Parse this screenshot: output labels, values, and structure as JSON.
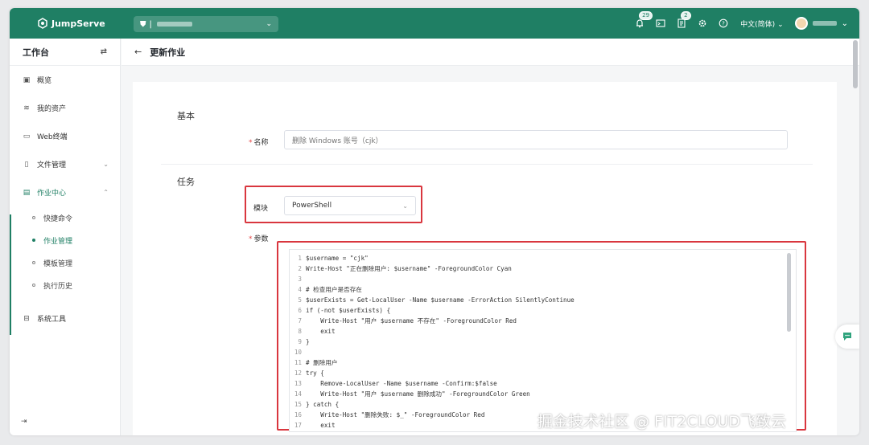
{
  "brand": {
    "name": "JumpServe",
    "color": "#1f7f64"
  },
  "topbar": {
    "org_icon": "org-icon",
    "org_separator": "|",
    "notifications_badge": "29",
    "tasks_badge": "2",
    "language": "中文(简体)"
  },
  "sidebar": {
    "header": "工作台",
    "toggle_icon": "⇄",
    "items": [
      {
        "label": "概览",
        "icon": "overview-icon"
      },
      {
        "label": "我的资产",
        "icon": "assets-icon"
      },
      {
        "label": "Web终端",
        "icon": "terminal-icon"
      },
      {
        "label": "文件管理",
        "icon": "file-icon"
      },
      {
        "label": "作业中心",
        "icon": "job-icon"
      },
      {
        "label": "系统工具",
        "icon": "tools-icon"
      }
    ],
    "sub_items": [
      {
        "label": "快捷命令"
      },
      {
        "label": "作业管理"
      },
      {
        "label": "模板管理"
      },
      {
        "label": "执行历史"
      }
    ]
  },
  "page": {
    "back_icon": "←",
    "title": "更新作业"
  },
  "form": {
    "section_basic": "基本",
    "name_label": "名称",
    "name_value": "删除 Windows 账号（cjk）",
    "section_task": "任务",
    "module_label": "模块",
    "module_value": "PowerShell",
    "params_label": "参数"
  },
  "code": {
    "lines": [
      {
        "no": "1",
        "text": "$username = \"cjk\""
      },
      {
        "no": "2",
        "text": "Write-Host \"正在删除用户: $username\" -ForegroundColor Cyan"
      },
      {
        "no": "3",
        "text": ""
      },
      {
        "no": "4",
        "text": "# 检查用户是否存在"
      },
      {
        "no": "5",
        "text": "$userExists = Get-LocalUser -Name $username -ErrorAction SilentlyContinue"
      },
      {
        "no": "6",
        "text": "if (-not $userExists) {"
      },
      {
        "no": "7",
        "text": "    Write-Host \"用户 $username 不存在\" -ForegroundColor Red"
      },
      {
        "no": "8",
        "text": "    exit"
      },
      {
        "no": "9",
        "text": "}"
      },
      {
        "no": "10",
        "text": ""
      },
      {
        "no": "11",
        "text": "# 删除用户"
      },
      {
        "no": "12",
        "text": "try {"
      },
      {
        "no": "13",
        "text": "    Remove-LocalUser -Name $username -Confirm:$false"
      },
      {
        "no": "14",
        "text": "    Write-Host \"用户 $username 删除成功\" -ForegroundColor Green"
      },
      {
        "no": "15",
        "text": "} catch {"
      },
      {
        "no": "16",
        "text": "    Write-Host \"删除失败: $_\" -ForegroundColor Red"
      },
      {
        "no": "17",
        "text": "    exit"
      }
    ]
  },
  "watermark": "掘金技术社区 @ FIT2CLOUD飞致云",
  "colors": {
    "highlight_box": "#d9363e",
    "active": "#1f7f64"
  }
}
